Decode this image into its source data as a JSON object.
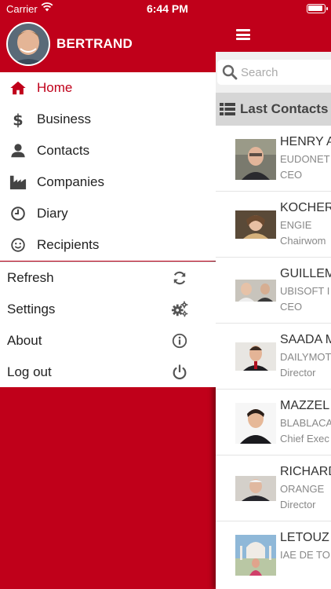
{
  "status_bar": {
    "carrier": "Carrier",
    "time": "6:44 PM"
  },
  "user": {
    "name": "BERTRAND"
  },
  "menu": [
    {
      "label": "Home",
      "icon": "home-icon",
      "active": true
    },
    {
      "label": "Business",
      "icon": "dollar-icon"
    },
    {
      "label": "Contacts",
      "icon": "person-icon"
    },
    {
      "label": "Companies",
      "icon": "factory-icon"
    },
    {
      "label": "Diary",
      "icon": "clock-icon"
    },
    {
      "label": "Recipients",
      "icon": "smiley-icon"
    }
  ],
  "actions": [
    {
      "label": "Refresh",
      "icon": "refresh-icon"
    },
    {
      "label": "Settings",
      "icon": "gears-icon"
    },
    {
      "label": "About",
      "icon": "info-icon"
    },
    {
      "label": "Log out",
      "icon": "power-icon"
    }
  ],
  "search": {
    "placeholder": "Search"
  },
  "section": {
    "title": "Last Contacts"
  },
  "contacts": [
    {
      "name": "HENRY A",
      "company": "EUDONET",
      "role": "CEO"
    },
    {
      "name": "KOCHER",
      "company": "ENGIE",
      "role": "Chairwom"
    },
    {
      "name": "GUILLEM",
      "company": "UBISOFT I",
      "role": "CEO"
    },
    {
      "name": "SAADA M",
      "company": "DAILYMOT",
      "role": "Director"
    },
    {
      "name": "MAZZEL",
      "company": "BLABLACA",
      "role": "Chief Exec"
    },
    {
      "name": "RICHARD",
      "company": "ORANGE",
      "role": "Director"
    },
    {
      "name": "LETOUZ",
      "company": "IAE DE TO",
      "role": ""
    }
  ],
  "colors": {
    "brand": "#c0001a",
    "menu_text": "#222222",
    "active_text": "#c0001a"
  }
}
